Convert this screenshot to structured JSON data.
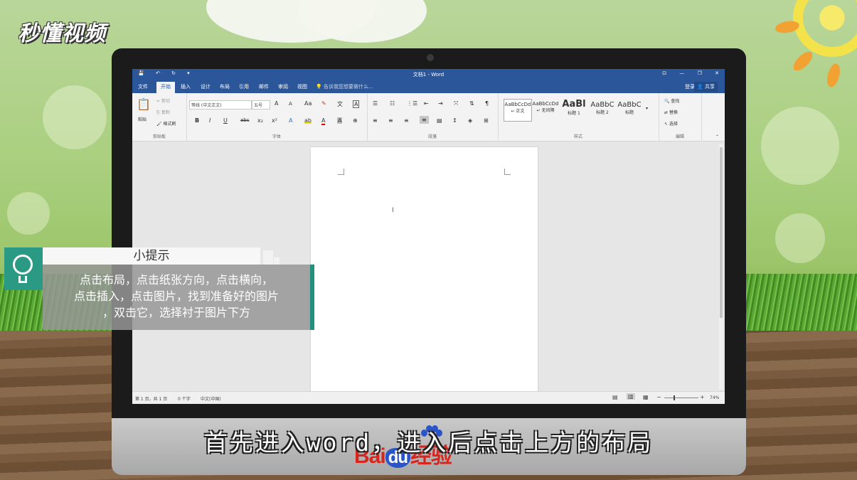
{
  "logo": {
    "text": "秒懂视频"
  },
  "window": {
    "title": "文档1 - Word",
    "quick_access": [
      "💾",
      "↶",
      "↻",
      "▾"
    ],
    "controls": [
      "⊡",
      "—",
      "❐",
      "✕"
    ]
  },
  "tabs": [
    {
      "label": "文件"
    },
    {
      "label": "开始"
    },
    {
      "label": "插入"
    },
    {
      "label": "设计"
    },
    {
      "label": "布局"
    },
    {
      "label": "引用"
    },
    {
      "label": "邮件"
    },
    {
      "label": "审阅"
    },
    {
      "label": "视图"
    }
  ],
  "tell_me": "告诉我您想要做什么...",
  "login": "登录",
  "share": "共享",
  "ribbon": {
    "clipboard": {
      "label": "剪贴板",
      "paste": "粘贴",
      "cut": "剪切",
      "copy": "复制",
      "format_painter": "格式刷"
    },
    "font": {
      "label": "字体",
      "name": "等线 (中文正文)",
      "size": "五号"
    },
    "paragraph": {
      "label": "段落"
    },
    "styles": {
      "label": "样式",
      "items": [
        {
          "preview": "AaBbCcDd",
          "name": "↵ 正文"
        },
        {
          "preview": "AaBbCcDd",
          "name": "↵ 无间隔"
        },
        {
          "preview": "AaBl",
          "name": "标题 1"
        },
        {
          "preview": "AaBbC",
          "name": "标题 2"
        },
        {
          "preview": "AaBbC",
          "name": "标题"
        }
      ]
    },
    "editing": {
      "label": "编辑",
      "find": "查找",
      "replace": "替换",
      "select": "选择"
    }
  },
  "status": {
    "page": "第 1 页，共 1 页",
    "words": "0 个字",
    "language": "中文(中国)",
    "zoom": "74%",
    "zoom_value": 74
  },
  "tip": {
    "title": "小提示",
    "lines": [
      "点击布局，点击纸张方向，点击横向，",
      "点击插入，点击图片，找到准备好的图片",
      "，双击它，选择衬于图片下方"
    ]
  },
  "subtitle": "首先进入word，进入后点击上方的布局",
  "watermark": {
    "bai": "Bai",
    "du": "du",
    "jingyan": "经验"
  }
}
